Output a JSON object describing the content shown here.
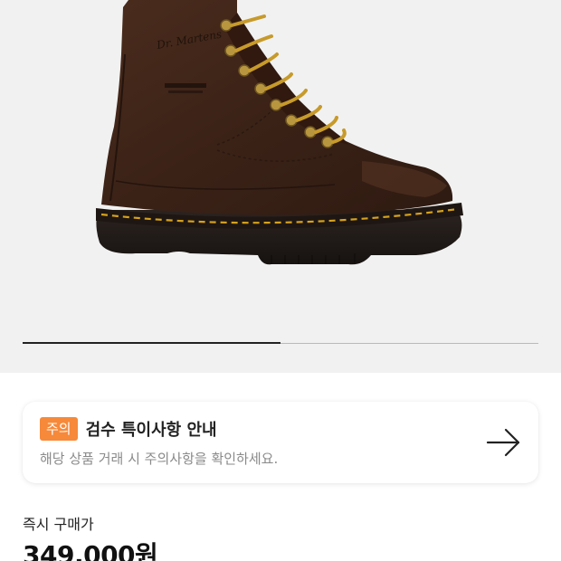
{
  "product": {
    "image_alt": "Dr. Martens 1460 dark brown leather boot",
    "image_brand_text": "Dr. Martens",
    "image_count": 2,
    "current_image": 1
  },
  "notice": {
    "badge": "주의",
    "title": "검수 특이사항 안내",
    "subtitle": "해당 상품 거래 시 주의사항을 확인하세요.",
    "arrow_icon": "arrow-right-icon"
  },
  "price": {
    "label": "즉시 구매가",
    "value": "349,000원"
  },
  "colors": {
    "badge": "#f6893a",
    "hero_bg": "#f1f1f1",
    "boot": "#3d2418",
    "stitch": "#d6a21c"
  }
}
